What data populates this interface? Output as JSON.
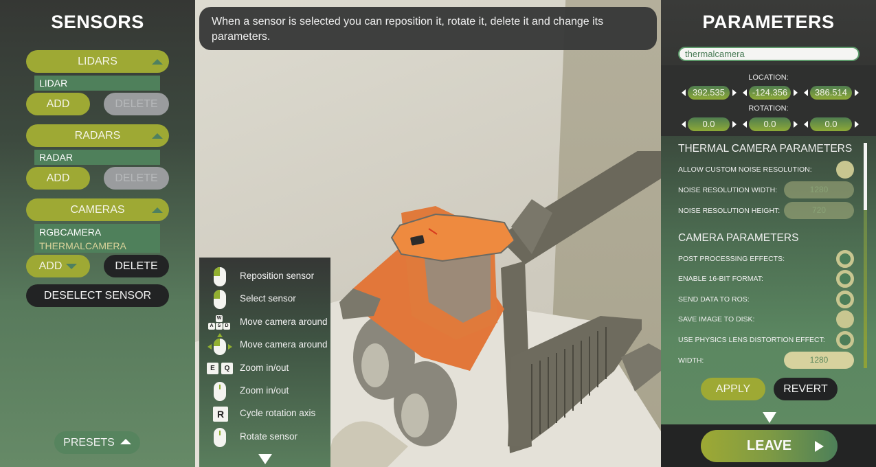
{
  "sensors_panel": {
    "title": "SENSORS",
    "categories": [
      {
        "label": "LIDARS",
        "items": [
          {
            "label": "LIDAR",
            "selected": false
          }
        ],
        "add_label": "ADD",
        "delete_label": "DELETE",
        "delete_enabled": false
      },
      {
        "label": "RADARS",
        "items": [
          {
            "label": "RADAR",
            "selected": false
          }
        ],
        "add_label": "ADD",
        "delete_label": "DELETE",
        "delete_enabled": false
      },
      {
        "label": "CAMERAS",
        "items": [
          {
            "label": "RGBCAMERA",
            "selected": false
          },
          {
            "label": "THERMALCAMERA",
            "selected": true
          }
        ],
        "add_label": "ADD",
        "delete_label": "DELETE",
        "delete_enabled": true
      }
    ],
    "deselect_label": "DESELECT SENSOR",
    "presets_label": "PRESETS"
  },
  "viewport": {
    "instruction": "When a sensor is selected you can reposition it, rotate it, delete it and change its parameters.",
    "controls": [
      {
        "icon": "mouse-left-button-icon",
        "label": "Reposition sensor"
      },
      {
        "icon": "mouse-right-button-icon",
        "label": "Select sensor"
      },
      {
        "icon": "wasd-keys-icon",
        "label": "Move camera around",
        "keys": [
          "W",
          "A",
          "S",
          "D"
        ]
      },
      {
        "icon": "mouse-drag-move-icon",
        "label": "Move camera around"
      },
      {
        "icon": "eq-keys-icon",
        "label": "Zoom in/out",
        "keys": [
          "E",
          "Q"
        ]
      },
      {
        "icon": "mouse-wheel-icon",
        "label": "Zoom in/out"
      },
      {
        "icon": "r-key-icon",
        "label": "Cycle rotation axis",
        "keys": [
          "R"
        ]
      },
      {
        "icon": "mouse-wheel-icon",
        "label": "Rotate sensor"
      }
    ]
  },
  "parameters_panel": {
    "title": "PARAMETERS",
    "sensor_name": "thermalcamera",
    "location_label": "LOCATION:",
    "location": [
      "392.535",
      "-124.356",
      "386.514"
    ],
    "rotation_label": "ROTATION:",
    "rotation": [
      "0.0",
      "0.0",
      "0.0"
    ],
    "thermal_section": {
      "title": "THERMAL CAMERA PARAMETERS",
      "allow_custom_noise_label": "ALLOW CUSTOM NOISE RESOLUTION:",
      "allow_custom_noise": false,
      "noise_width_label": "NOISE RESOLUTION WIDTH:",
      "noise_width": "1280",
      "noise_height_label": "NOISE RESOLUTION HEIGHT:",
      "noise_height": "720"
    },
    "camera_section": {
      "title": "CAMERA PARAMETERS",
      "toggles": [
        {
          "label": "POST PROCESSING EFFECTS:",
          "on": true
        },
        {
          "label": "ENABLE 16-BIT FORMAT:",
          "on": true
        },
        {
          "label": "SEND DATA TO ROS:",
          "on": true
        },
        {
          "label": "SAVE IMAGE TO DISK:",
          "on": false
        },
        {
          "label": "USE PHYSICS LENS DISTORTION EFFECT:",
          "on": true
        }
      ],
      "width_label": "WIDTH:",
      "width": "1280"
    },
    "apply_label": "APPLY",
    "revert_label": "REVERT",
    "leave_label": "LEAVE"
  }
}
